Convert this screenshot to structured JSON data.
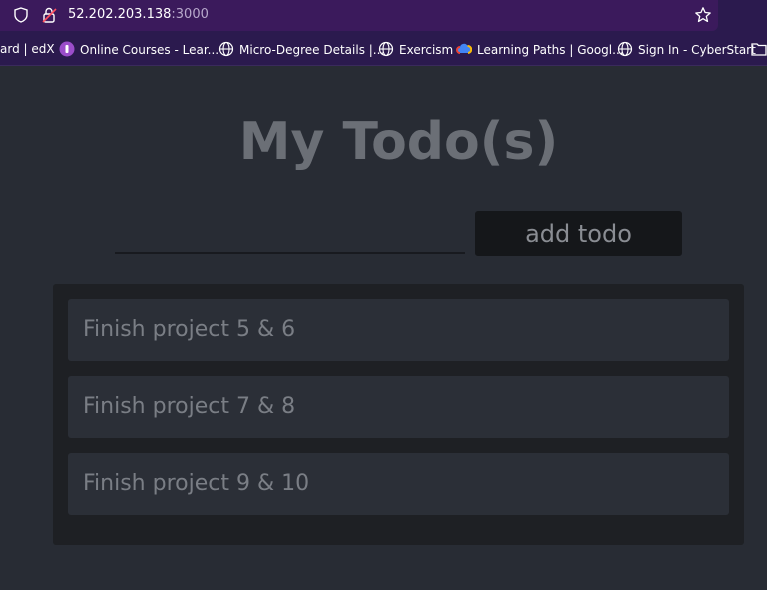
{
  "browser": {
    "url_host": "52.202.203.138",
    "url_port": ":3000",
    "bookmarks": [
      {
        "label": "ard | edX",
        "icon": "none"
      },
      {
        "label": "Online Courses - Lear...",
        "icon": "course-icon"
      },
      {
        "label": "Micro-Degree Details |...",
        "icon": "globe-icon"
      },
      {
        "label": "Exercism",
        "icon": "globe-icon"
      },
      {
        "label": "Learning Paths | Googl...",
        "icon": "cloud-icon"
      },
      {
        "label": "Sign In - CyberStart",
        "icon": "globe-icon"
      }
    ]
  },
  "app": {
    "title": "My Todo(s)",
    "input_value": "",
    "add_button_label": "add todo",
    "todos": [
      "Finish project 5 & 6",
      "Finish project 7 & 8",
      "Finish project 9 & 10"
    ]
  },
  "colors": {
    "background": "#282c34",
    "list_background": "#1e2024",
    "item_background": "#2b2f37",
    "button_background": "#15171a",
    "browser_chrome": "#2b1a4e"
  }
}
